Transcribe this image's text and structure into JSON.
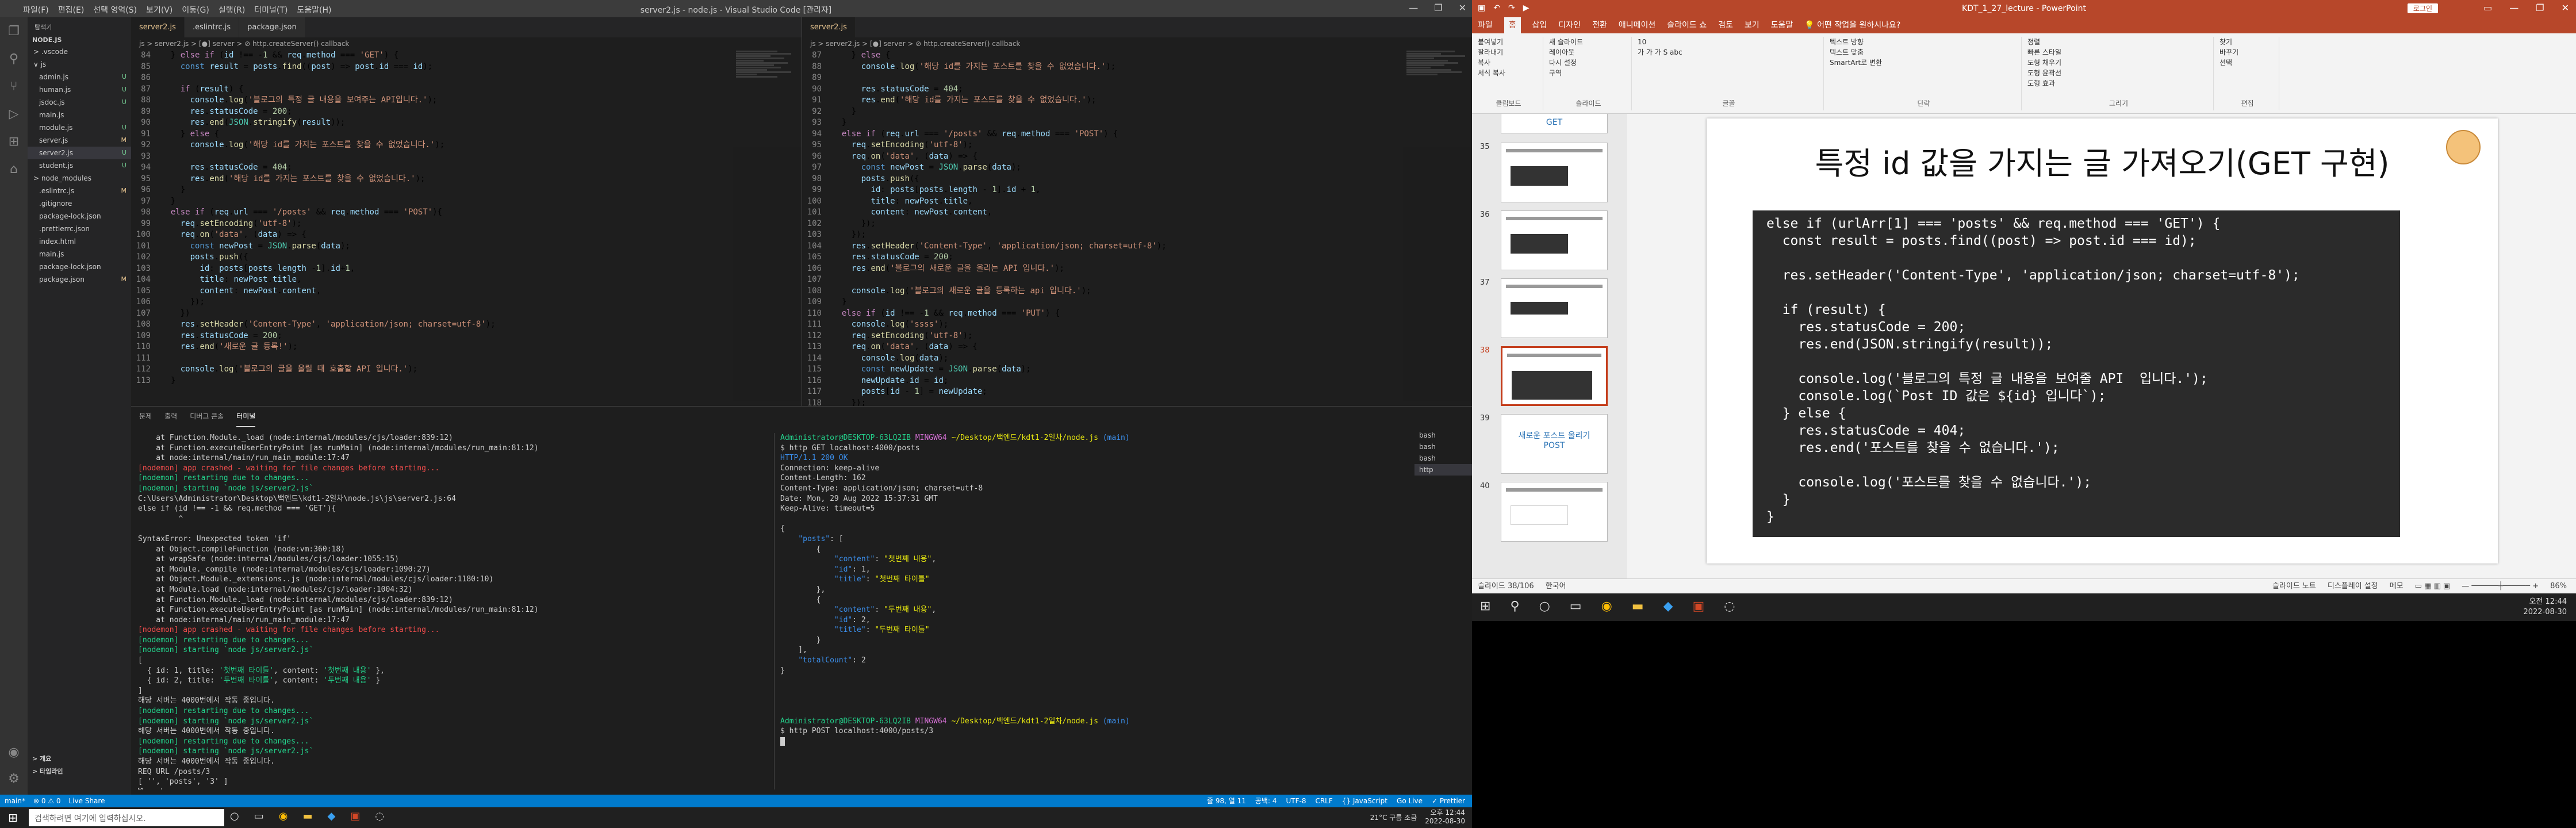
{
  "vscode": {
    "title": "server2.js - node.js - Visual Studio Code [관리자]",
    "menu": [
      "파일(F)",
      "편집(E)",
      "선택 영역(S)",
      "보기(V)",
      "이동(G)",
      "실행(R)",
      "터미널(T)",
      "도움말(H)"
    ],
    "explorer": {
      "header": "탐색기",
      "section": "NODE.JS",
      "files": [
        {
          "name": "> .vscode",
          "status": ""
        },
        {
          "name": "∨ js",
          "status": ""
        },
        {
          "name": "admin.js",
          "status": "U"
        },
        {
          "name": "human.js",
          "status": "U"
        },
        {
          "name": "jsdoc.js",
          "status": "U"
        },
        {
          "name": "main.js",
          "status": ""
        },
        {
          "name": "module.js",
          "status": "U"
        },
        {
          "name": "server.js",
          "status": "M"
        },
        {
          "name": "server2.js",
          "status": "U"
        },
        {
          "name": "student.js",
          "status": "U"
        },
        {
          "name": "> node_modules",
          "status": ""
        },
        {
          "name": ".eslintrc.js",
          "status": "M"
        },
        {
          "name": ".gitignore",
          "status": ""
        },
        {
          "name": "package-lock.json",
          "status": ""
        },
        {
          "name": ".prettierrc.json",
          "status": ""
        },
        {
          "name": "index.html",
          "status": ""
        },
        {
          "name": "main.js",
          "status": ""
        },
        {
          "name": "package-lock.json",
          "status": ""
        },
        {
          "name": "package.json",
          "status": "M"
        }
      ],
      "bottom_sections": [
        "> 개요",
        "> 타임라인"
      ]
    },
    "left_editor": {
      "tabs": [
        {
          "label": "server2.js",
          "active": true
        },
        {
          "label": ".eslintrc.js",
          "active": false
        },
        {
          "label": "package.json",
          "active": false
        }
      ],
      "breadcrumb": "js > server2.js > [●] server > ⊘ http.createServer() callback"
    },
    "right_editor": {
      "tabs": [
        {
          "label": "server2.js",
          "active": true
        }
      ],
      "breadcrumb": "js > server2.js > [●] server > ⊘ http.createServer() callback"
    },
    "panel_tabs": [
      "문제",
      "출력",
      "디버그 콘솔",
      "터미널"
    ],
    "terminal_list": [
      "bash",
      "bash",
      "bash",
      "http"
    ],
    "status_left": [
      "main*",
      "⊗ 0 ⚠ 0",
      "Live Share"
    ],
    "status_right": [
      "줄 98, 열 11",
      "공백: 4",
      "UTF-8",
      "CRLF",
      "{} JavaScript",
      "Go Live",
      "✓ Prettier"
    ],
    "taskbar_search": "검색하려면 여기에 입력하십시오.",
    "taskbar_tray": [
      "21°C 구름 조금",
      "오후 12:44",
      "2022-08-30"
    ]
  },
  "powerpoint": {
    "title": "KDT_1_27_lecture  -  PowerPoint",
    "login_button": "로그인",
    "menu": [
      "파일",
      "홈",
      "삽입",
      "디자인",
      "전환",
      "애니메이션",
      "슬라이드 쇼",
      "검토",
      "보기",
      "도움말",
      "어떤 작업을 원하시나요?"
    ],
    "ribbon_groups": [
      {
        "label": "클립보드",
        "items": [
          "붙여넣기",
          "잘라내기",
          "복사",
          "서식 복사"
        ]
      },
      {
        "label": "슬라이드",
        "items": [
          "새 슬라이드",
          "레이아웃",
          "다시 설정",
          "구역"
        ]
      },
      {
        "label": "글꼴",
        "items": [
          "10",
          "가 가 가 S abc"
        ]
      },
      {
        "label": "단락",
        "items": [
          "텍스트 방향",
          "텍스트 맞춤",
          "SmartArt로 변환"
        ]
      },
      {
        "label": "그리기",
        "items": [
          "정렬",
          "빠른 스타일",
          "도형 채우기",
          "도형 윤곽선",
          "도형 효과"
        ]
      },
      {
        "label": "편집",
        "items": [
          "찾기",
          "바꾸기",
          "선택"
        ]
      }
    ],
    "slide_thumbnails": [
      {
        "num": "",
        "text": "GET",
        "selected": false
      },
      {
        "num": "35",
        "text": "",
        "selected": false
      },
      {
        "num": "36",
        "text": "",
        "selected": false
      },
      {
        "num": "37",
        "text": "",
        "selected": false
      },
      {
        "num": "38",
        "text": "",
        "selected": true
      },
      {
        "num": "39",
        "text": "새로운 포스트 올리기 POST",
        "selected": false
      },
      {
        "num": "40",
        "text": "",
        "selected": false
      }
    ],
    "slide": {
      "title": "특정 id 값을 가지는 글 가져오기(GET 구현)",
      "code_lines": [
        "else if (urlArr[1] === 'posts' && req.method === 'GET') {",
        "  const result = posts.find((post) => post.id === id);",
        "",
        "  res.setHeader('Content-Type', 'application/json; charset=utf-8');",
        "",
        "  if (result) {",
        "    res.statusCode = 200;",
        "    res.end(JSON.stringify(result));",
        "",
        "    console.log('블로그의 특정 글 내용을 보여줄 API  입니다.');",
        "    console.log(`Post ID 값은 ${id} 입니다`);",
        "  } else {",
        "    res.statusCode = 404;",
        "    res.end('포스트를 찾을 수 없습니다.');",
        "",
        "    console.log('포스트를 찾을 수 없습니다.');",
        "  }",
        "}"
      ]
    },
    "status_left": [
      "슬라이드 38/106",
      "한국어"
    ],
    "status_right": [
      "슬라이드 노트",
      "디스플레이 설정",
      "메모",
      "86%"
    ],
    "clock": {
      "time": "오전 12:44",
      "date": "2022-08-30"
    }
  }
}
